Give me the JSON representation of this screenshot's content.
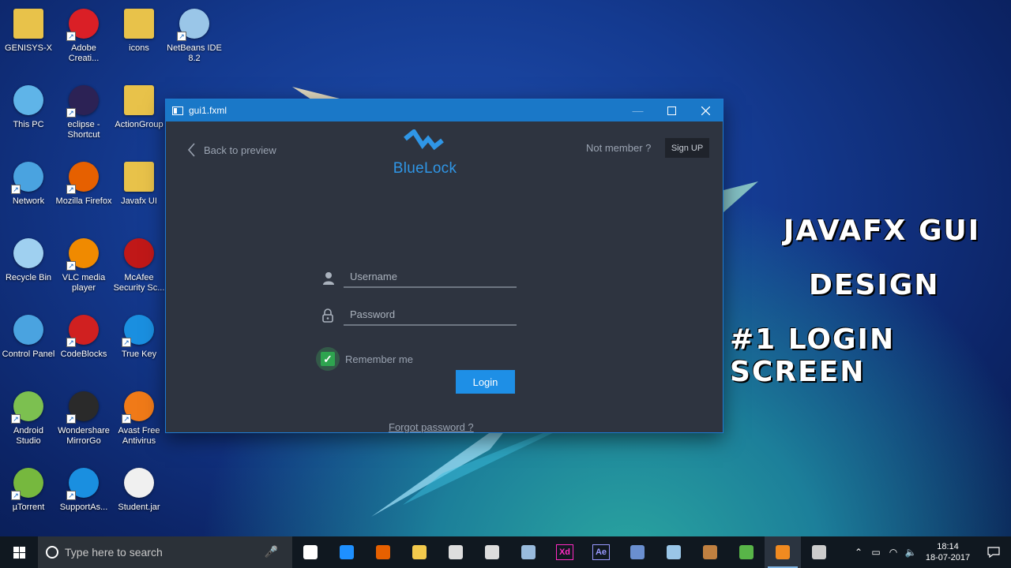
{
  "desktop": {
    "icons": [
      {
        "label": "GENISYS-X",
        "icon": "folder-person-icon",
        "color": "#e8c24a"
      },
      {
        "label": "Adobe Creati...",
        "icon": "adobe-cc-icon",
        "color": "#da1f26"
      },
      {
        "label": "icons",
        "icon": "folder-icon",
        "color": "#e8c24a"
      },
      {
        "label": "NetBeans IDE 8.2",
        "icon": "netbeans-icon",
        "color": "#9ac6e8"
      },
      {
        "label": "This PC",
        "icon": "computer-icon",
        "color": "#5fb4e8"
      },
      {
        "label": "eclipse - Shortcut",
        "icon": "eclipse-icon",
        "color": "#2c2255"
      },
      {
        "label": "ActionGroup",
        "icon": "folder-icon",
        "color": "#e8c24a"
      },
      {
        "label": "Network",
        "icon": "network-icon",
        "color": "#4aa3e0"
      },
      {
        "label": "Mozilla Firefox",
        "icon": "firefox-icon",
        "color": "#e66000"
      },
      {
        "label": "Javafx UI",
        "icon": "folder-icon",
        "color": "#e8c24a"
      },
      {
        "label": "Recycle Bin",
        "icon": "recycle-bin-icon",
        "color": "#9fd0f0"
      },
      {
        "label": "VLC media player",
        "icon": "vlc-icon",
        "color": "#f08a00"
      },
      {
        "label": "McAfee Security Sc...",
        "icon": "mcafee-icon",
        "color": "#c01818"
      },
      {
        "label": "Control Panel",
        "icon": "control-panel-icon",
        "color": "#4aa3e0"
      },
      {
        "label": "CodeBlocks",
        "icon": "codeblocks-icon",
        "color": "#d02020"
      },
      {
        "label": "True Key",
        "icon": "truekey-icon",
        "color": "#1a8fe0"
      },
      {
        "label": "Android Studio",
        "icon": "android-studio-icon",
        "color": "#7cc050"
      },
      {
        "label": "Wondershare MirrorGo",
        "icon": "mirrorgo-icon",
        "color": "#2a2a2a"
      },
      {
        "label": "Avast Free Antivirus",
        "icon": "avast-icon",
        "color": "#f07a18"
      },
      {
        "label": "µTorrent",
        "icon": "utorrent-icon",
        "color": "#76b83e"
      },
      {
        "label": "SupportAs...",
        "icon": "support-assistant-icon",
        "color": "#1a8fe0"
      },
      {
        "label": "Student.jar",
        "icon": "java-jar-icon",
        "color": "#f0f0f0"
      }
    ]
  },
  "window": {
    "title": "gui1.fxml",
    "back_label": "Back to preview",
    "brand": "BlueLock",
    "not_member": "Not member ?",
    "sign_up": "Sign UP",
    "username_placeholder": "Username",
    "password_placeholder": "Password",
    "remember_label": "Remember me",
    "remember_checked": true,
    "login_label": "Login",
    "forgot_label": "Forgot password ?",
    "accent": "#1e8fe6"
  },
  "overlay": {
    "line1": "JAVAFX GUI",
    "line2": "DESIGN",
    "line3": "#1  LOGIN SCREEN"
  },
  "taskbar": {
    "search_placeholder": "Type here to search",
    "apps": [
      {
        "icon": "task-view-icon"
      },
      {
        "icon": "edge-icon"
      },
      {
        "icon": "firefox-icon"
      },
      {
        "icon": "file-explorer-icon"
      },
      {
        "icon": "store-icon"
      },
      {
        "icon": "groove-icon"
      },
      {
        "icon": "app-icon"
      },
      {
        "icon": "xd-icon",
        "text": "Xd"
      },
      {
        "icon": "after-effects-icon",
        "text": "Ae"
      },
      {
        "icon": "visual-studio-icon"
      },
      {
        "icon": "netbeans-icon"
      },
      {
        "icon": "app-icon"
      },
      {
        "icon": "camtasia-icon"
      },
      {
        "icon": "app-icon"
      },
      {
        "icon": "app-icon"
      }
    ],
    "time": "18:14",
    "date": "18-07-2017"
  }
}
